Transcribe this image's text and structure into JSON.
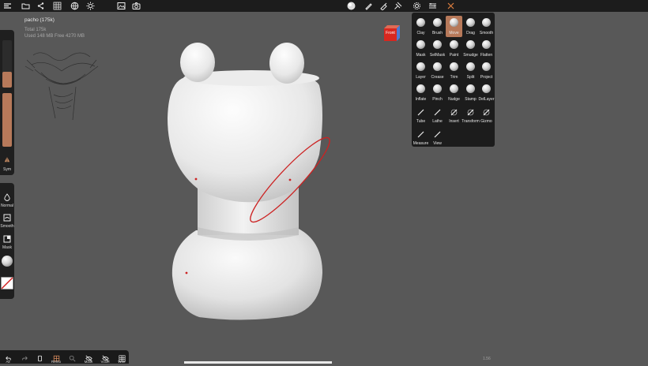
{
  "topbar": {
    "left_icons": [
      "menu-icon",
      "folder-icon",
      "scene-tree-icon",
      "grid-icon",
      "globe-icon",
      "sun-icon",
      "image-icon",
      "camera-icon"
    ],
    "right_icons": [
      "material-sphere-icon",
      "brush-pen-icon",
      "paint-pen-icon",
      "pin-icon",
      "gear-icon",
      "layers-icon",
      "tools-icon"
    ]
  },
  "scene": {
    "name": "pacho (175k)",
    "total": "Total 175k",
    "memory": "Used 148 MB  Free 4270 MB"
  },
  "leftbar": {
    "sym_label": "Sym",
    "normal_label": "Normal",
    "smooth_label": "Smooth",
    "mask_label": "Mask"
  },
  "viewcube": {
    "face_label": "Front"
  },
  "tools": [
    {
      "label": "Clay",
      "selected": false
    },
    {
      "label": "Brush",
      "selected": false
    },
    {
      "label": "Move",
      "selected": true
    },
    {
      "label": "Drag",
      "selected": false
    },
    {
      "label": "Smooth",
      "selected": false
    },
    {
      "label": "Mask",
      "selected": false
    },
    {
      "label": "SelMask",
      "selected": false
    },
    {
      "label": "Paint",
      "selected": false
    },
    {
      "label": "Smudge",
      "selected": false
    },
    {
      "label": "Flatten",
      "selected": false
    },
    {
      "label": "Layer",
      "selected": false
    },
    {
      "label": "Crease",
      "selected": false
    },
    {
      "label": "Trim",
      "selected": false
    },
    {
      "label": "Split",
      "selected": false
    },
    {
      "label": "Project",
      "selected": false
    },
    {
      "label": "Inflate",
      "selected": false
    },
    {
      "label": "Pinch",
      "selected": false
    },
    {
      "label": "Nudge",
      "selected": false
    },
    {
      "label": "Stamp",
      "selected": false
    },
    {
      "label": "DelLayer",
      "selected": false
    },
    {
      "label": "Tube",
      "selected": false
    },
    {
      "label": "Lathe",
      "selected": false
    },
    {
      "label": "Insert",
      "selected": false
    },
    {
      "label": "Transform",
      "selected": false
    },
    {
      "label": "Gizmo",
      "selected": false
    },
    {
      "label": "Measure",
      "selected": false
    },
    {
      "label": "View",
      "selected": false
    }
  ],
  "bottombar": [
    "All",
    "",
    "",
    "Remo",
    "",
    "Mask",
    "Voxel",
    "Wire"
  ],
  "frame_value": "1.56",
  "colors": {
    "accent": "#b7795a",
    "panel": "#1c1c1c",
    "background": "#585858",
    "stroke": "#cc2222"
  }
}
